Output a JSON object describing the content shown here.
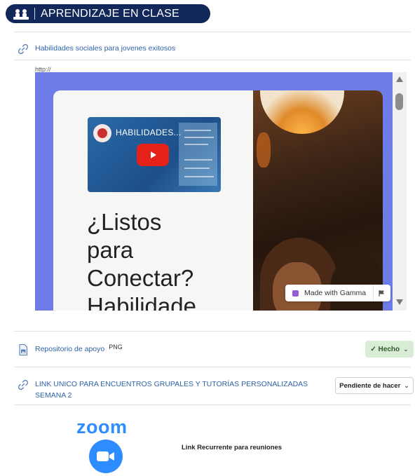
{
  "header": {
    "title": "APRENDIZAJE EN CLASE"
  },
  "link1": {
    "title": "Habilidades sociales para jovenes exitosos",
    "url": "http://"
  },
  "embed": {
    "thumbnail_title": "HABILIDADES...",
    "heading_lines": [
      "¿Listos",
      "para",
      "Conectar?",
      "Habilidade"
    ],
    "badge": "Made with Gamma"
  },
  "file": {
    "name": "Repositorio de apoyo",
    "type": "PNG",
    "status": "Hecho"
  },
  "link2": {
    "title_line1": "LINK UNICO PARA ENCUENTROS GRUPALES Y TUTORÍAS PERSONALIZADAS",
    "title_line2": "SEMANA 2",
    "status": "Pendiente de hacer"
  },
  "zoom": {
    "wordmark": "zoom",
    "caption": "Link Recurrente para reuniones"
  },
  "colors": {
    "header_bg": "#12285a",
    "link": "#2f62a6",
    "embed_bg": "#6e7ce8",
    "zoom": "#2d8cff",
    "done_bg": "#d9ecd6"
  }
}
